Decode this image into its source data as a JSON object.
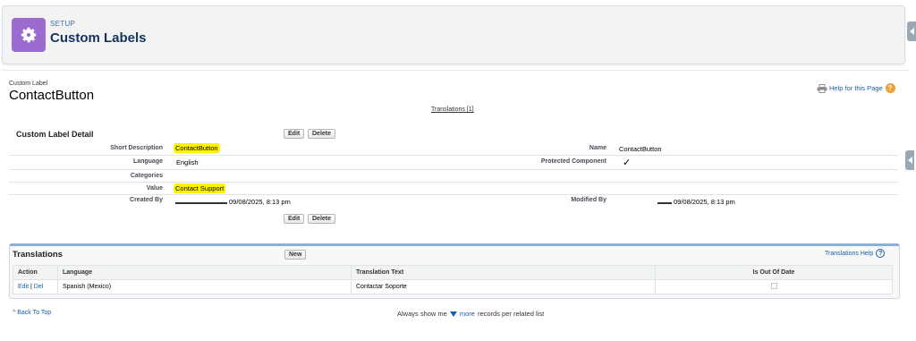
{
  "header": {
    "eyebrow": "SETUP",
    "title": "Custom Labels"
  },
  "page": {
    "type": "Custom Label",
    "name": "ContactButton",
    "help_link": "Help for this Page",
    "translations_link": "Translations [1]"
  },
  "detail": {
    "title": "Custom Label Detail",
    "edit_label": "Edit",
    "delete_label": "Delete",
    "fields": {
      "short_description": {
        "label": "Short Description",
        "value": "ContactButton"
      },
      "language": {
        "label": "Language",
        "value": "English"
      },
      "categories": {
        "label": "Categories",
        "value": ""
      },
      "value": {
        "label": "Value",
        "value": "Contact Support"
      },
      "created_by": {
        "label": "Created By",
        "value": "09/08/2025, 8:13 pm"
      },
      "name": {
        "label": "Name",
        "value": "ContactButton"
      },
      "protected": {
        "label": "Protected Component",
        "value": "✓"
      },
      "modified_by": {
        "label": "Modified By",
        "value": "09/08/2025, 8:13 pm"
      }
    }
  },
  "translations": {
    "title": "Translations",
    "new_label": "New",
    "help_label": "Translations Help",
    "columns": [
      "Action",
      "Language",
      "Translation Text",
      "Is Out Of Date"
    ],
    "rows": [
      {
        "edit": "Edit",
        "sep": "|",
        "del": "Del",
        "language": "Spanish (Mexico)",
        "text": "Contactar Soporte"
      }
    ]
  },
  "footer": {
    "back_to_top": "Back To Top",
    "always_show_prefix": "Always show me",
    "more": "more",
    "always_show_suffix": "records per related list"
  },
  "colors": {
    "accent": "#9c6bd0",
    "link": "#1a5fa8",
    "highlight": "#fff200",
    "help": "#e8a33c"
  }
}
